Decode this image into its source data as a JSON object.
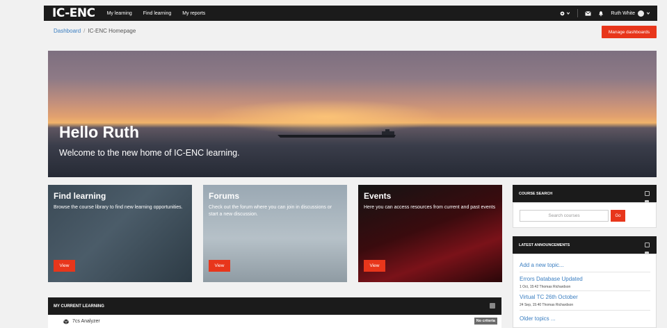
{
  "nav": {
    "logo": "IC-ENC",
    "links": [
      "My learning",
      "Find learning",
      "My reports"
    ],
    "user_name": "Ruth White"
  },
  "breadcrumb": {
    "home": "Dashboard",
    "separator": "/",
    "current": "IC-ENC Homepage"
  },
  "manage_button": "Manage dashboards",
  "hero": {
    "title": "Hello Ruth",
    "subtitle": "Welcome to the new home of IC-ENC learning."
  },
  "cards": [
    {
      "title": "Find learning",
      "description": "Browse the course library to find new learning opportunities.",
      "button": "View"
    },
    {
      "title": "Forums",
      "description": "Check out the forum where you can join in discussions or start a new discussion.",
      "button": "View"
    },
    {
      "title": "Events",
      "description": "Here you can access resources from current and past events",
      "button": "View"
    }
  ],
  "current_learning": {
    "heading": "MY CURRENT LEARNING",
    "rows": [
      {
        "name": "7cs Analyzer",
        "badge": "No criteria"
      }
    ]
  },
  "course_search": {
    "heading": "COURSE SEARCH",
    "placeholder": "Search courses",
    "go": "Go"
  },
  "announcements": {
    "heading": "LATEST ANNOUNCEMENTS",
    "add": "Add a new topic...",
    "items": [
      {
        "title": "Errors Database Updated",
        "meta": "1 Oct, 15:42 Thomas Richardson"
      },
      {
        "title": "Virtual TC 26th October",
        "meta": "24 Sep, 15:40 Thomas Richardson"
      }
    ],
    "older": "Older topics ..."
  },
  "colors": {
    "accent": "#e8361b",
    "nav_bg": "#1b1b1b",
    "link": "#3a7ec1"
  },
  "icons": [
    "settings-icon",
    "chevron-down-icon",
    "mail-icon",
    "bell-icon",
    "user-avatar-icon",
    "course-cube-icon",
    "block-toggle-icon"
  ]
}
